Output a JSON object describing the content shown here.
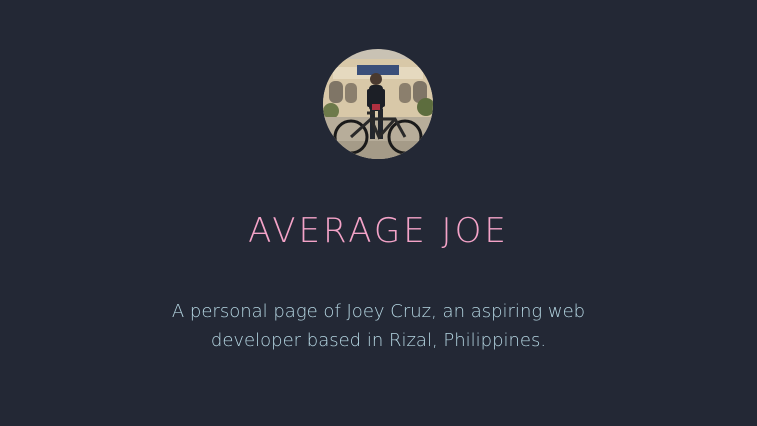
{
  "hero": {
    "avatar_icon": "profile-photo-cyclist",
    "title": "AVERAGE JOE",
    "description": "A personal page of Joey Cruz, an aspiring web developer based in Rizal, Philippines."
  },
  "colors": {
    "background": "#232835",
    "title": "#f4a3c8",
    "description": "#b6d7e3"
  }
}
